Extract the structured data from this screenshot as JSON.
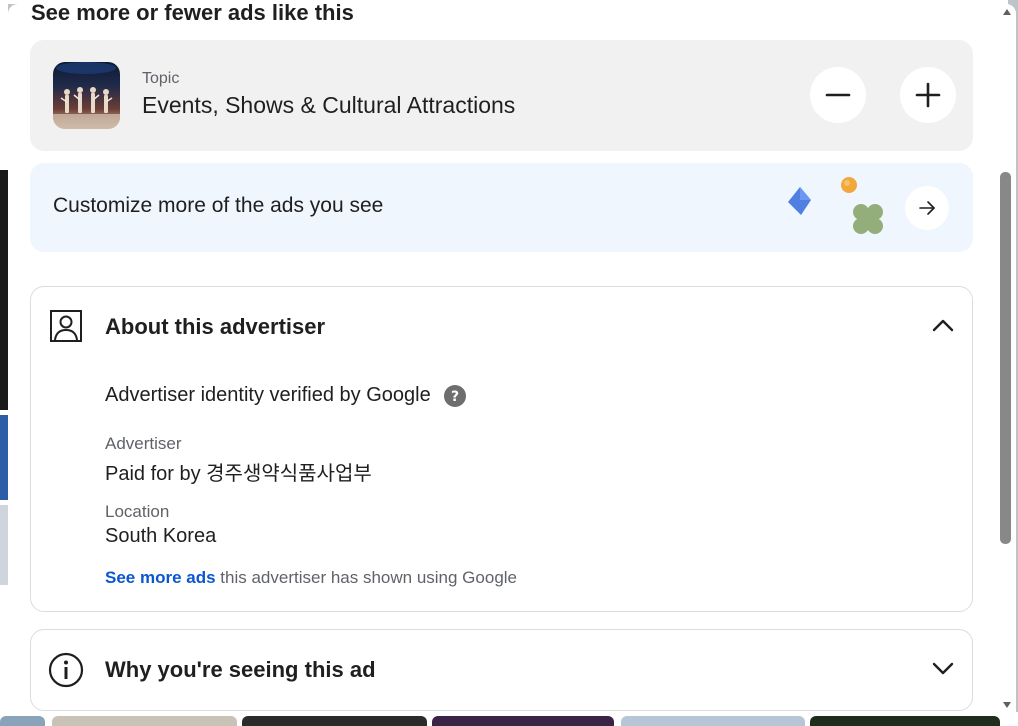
{
  "panel": {
    "section_title": "See more or fewer ads like this"
  },
  "topic_card": {
    "label": "Topic",
    "name": "Events, Shows & Cultural Attractions",
    "fewer_icon": "minus-icon",
    "more_icon": "plus-icon"
  },
  "customize_card": {
    "text": "Customize more of the ads you see",
    "arrow_icon": "arrow-right-icon"
  },
  "about_advertiser": {
    "title": "About this advertiser",
    "icon": "person-icon",
    "expanded": true,
    "verified_text": "Advertiser identity verified by Google",
    "help_icon": "help-icon",
    "advertiser_label": "Advertiser",
    "advertiser_value": "Paid for by 경주생약식품사업부",
    "location_label": "Location",
    "location_value": "South Korea",
    "see_more_link": "See more ads",
    "see_more_rest": " this advertiser has shown using Google"
  },
  "why_card": {
    "title": "Why you're seeing this ad",
    "icon": "info-icon",
    "expanded": false
  },
  "colors": {
    "link": "#0b57d0",
    "topic_bg": "#f1f1f1",
    "customize_bg": "#eff6fd",
    "text": "#1f1f1f",
    "muted": "#5f6368",
    "scroll_thumb": "#888888"
  }
}
